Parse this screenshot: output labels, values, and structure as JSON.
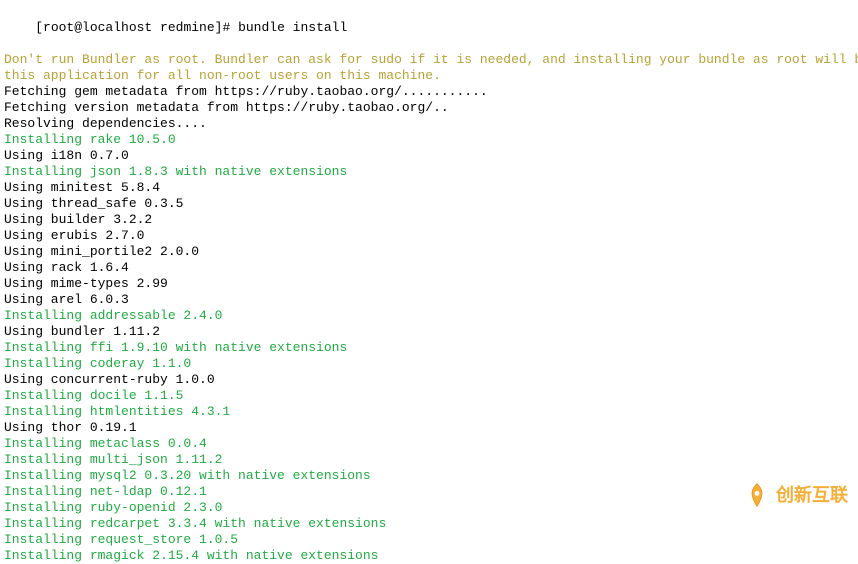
{
  "prompt": {
    "user_host": "[root@localhost redmine]#",
    "command": " bundle install"
  },
  "lines": [
    {
      "text": "Don't run Bundler as root. Bundler can ask for sudo if it is needed, and installing your bundle as root will break",
      "color": "warn"
    },
    {
      "text": "this application for all non-root users on this machine.",
      "color": "warn"
    },
    {
      "text": "Fetching gem metadata from https://ruby.taobao.org/...........",
      "color": "default"
    },
    {
      "text": "Fetching version metadata from https://ruby.taobao.org/..",
      "color": "default"
    },
    {
      "text": "Resolving dependencies....",
      "color": "default"
    },
    {
      "text": "Installing rake 10.5.0",
      "color": "success"
    },
    {
      "text": "Using i18n 0.7.0",
      "color": "default"
    },
    {
      "text": "Installing json 1.8.3 with native extensions",
      "color": "success"
    },
    {
      "text": "Using minitest 5.8.4",
      "color": "default"
    },
    {
      "text": "Using thread_safe 0.3.5",
      "color": "default"
    },
    {
      "text": "Using builder 3.2.2",
      "color": "default"
    },
    {
      "text": "Using erubis 2.7.0",
      "color": "default"
    },
    {
      "text": "Using mini_portile2 2.0.0",
      "color": "default"
    },
    {
      "text": "Using rack 1.6.4",
      "color": "default"
    },
    {
      "text": "Using mime-types 2.99",
      "color": "default"
    },
    {
      "text": "Using arel 6.0.3",
      "color": "default"
    },
    {
      "text": "Installing addressable 2.4.0",
      "color": "success"
    },
    {
      "text": "Using bundler 1.11.2",
      "color": "default"
    },
    {
      "text": "Installing ffi 1.9.10 with native extensions",
      "color": "success"
    },
    {
      "text": "Installing coderay 1.1.0",
      "color": "success"
    },
    {
      "text": "Using concurrent-ruby 1.0.0",
      "color": "default"
    },
    {
      "text": "Installing docile 1.1.5",
      "color": "success"
    },
    {
      "text": "Installing htmlentities 4.3.1",
      "color": "success"
    },
    {
      "text": "Using thor 0.19.1",
      "color": "default"
    },
    {
      "text": "Installing metaclass 0.0.4",
      "color": "success"
    },
    {
      "text": "Installing multi_json 1.11.2",
      "color": "success"
    },
    {
      "text": "Installing mysql2 0.3.20 with native extensions",
      "color": "success"
    },
    {
      "text": "Installing net-ldap 0.12.1",
      "color": "success"
    },
    {
      "text": "Installing ruby-openid 2.3.0",
      "color": "success"
    },
    {
      "text": "Installing redcarpet 3.3.4 with native extensions",
      "color": "success"
    },
    {
      "text": "Installing request_store 1.0.5",
      "color": "success"
    },
    {
      "text": "Installing rmagick 2.15.4 with native extensions",
      "color": "success"
    }
  ],
  "watermark": {
    "text": "创新互联"
  }
}
